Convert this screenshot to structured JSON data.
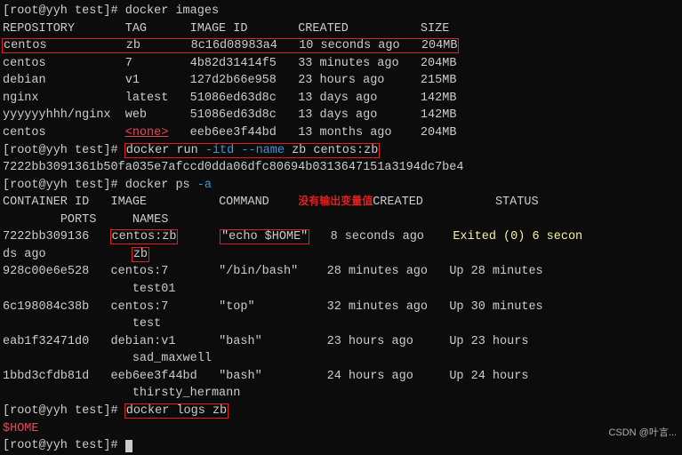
{
  "prompt": "[root@yyh test]#",
  "cmd_images": "docker images",
  "images_header": {
    "repo": "REPOSITORY",
    "tag": "TAG",
    "id": "IMAGE ID",
    "created": "CREATED",
    "size": "SIZE"
  },
  "images": [
    {
      "repo": "centos",
      "tag": "zb",
      "id": "8c16d08983a4",
      "created": "10 seconds ago",
      "size": "204MB"
    },
    {
      "repo": "centos",
      "tag": "7",
      "id": "4b82d31414f5",
      "created": "33 minutes ago",
      "size": "204MB"
    },
    {
      "repo": "debian",
      "tag": "v1",
      "id": "127d2b66e958",
      "created": "23 hours ago",
      "size": "215MB"
    },
    {
      "repo": "nginx",
      "tag": "latest",
      "id": "51086ed63d8c",
      "created": "13 days ago",
      "size": "142MB"
    },
    {
      "repo": "yyyyyyhhh/nginx",
      "tag": "web",
      "id": "51086ed63d8c",
      "created": "13 days ago",
      "size": "142MB"
    },
    {
      "repo": "centos",
      "tag": "<none>",
      "id": "eeb6ee3f44bd",
      "created": "13 months ago",
      "size": "204MB"
    }
  ],
  "cmd_run_prefix": "docker run ",
  "cmd_run_opt1": "-itd",
  "cmd_run_opt2": "--name",
  "cmd_run_args": " zb centos:zb",
  "run_output": "7222bb3091361b50fa035e7afccd0dda06dfc80694b0313647151a3194dc7be4",
  "cmd_ps": "docker ps ",
  "cmd_ps_opt": "-a",
  "ps_header": {
    "cid": "CONTAINER ID",
    "image": "IMAGE",
    "command": "COMMAND",
    "created": "CREATED",
    "status": "STATUS",
    "ports": "PORTS",
    "names": "NAMES"
  },
  "annotation": "没有输出变量值",
  "ps": [
    {
      "cid": "7222bb309136",
      "image": "centos:zb",
      "command": "\"echo $HOME\"",
      "created": "8 seconds ago",
      "status": "Exited (0) 6 secon",
      "ports": "ds ago",
      "names": "zb"
    },
    {
      "cid": "928c00e6e528",
      "image": "centos:7",
      "command": "\"/bin/bash\"",
      "created": "28 minutes ago",
      "status": "Up 28 minutes",
      "ports": "",
      "names": "test01"
    },
    {
      "cid": "6c198084c38b",
      "image": "centos:7",
      "command": "\"top\"",
      "created": "32 minutes ago",
      "status": "Up 30 minutes",
      "ports": "",
      "names": "test"
    },
    {
      "cid": "eab1f32471d0",
      "image": "debian:v1",
      "command": "\"bash\"",
      "created": "23 hours ago",
      "status": "Up 23 hours",
      "ports": "",
      "names": "sad_maxwell"
    },
    {
      "cid": "1bbd3cfdb81d",
      "image": "eeb6ee3f44bd",
      "command": "\"bash\"",
      "created": "24 hours ago",
      "status": "Up 24 hours",
      "ports": "",
      "names": "thirsty_hermann"
    }
  ],
  "cmd_logs": "docker logs zb",
  "logs_output": "$HOME",
  "watermark": "CSDN @叶言..."
}
